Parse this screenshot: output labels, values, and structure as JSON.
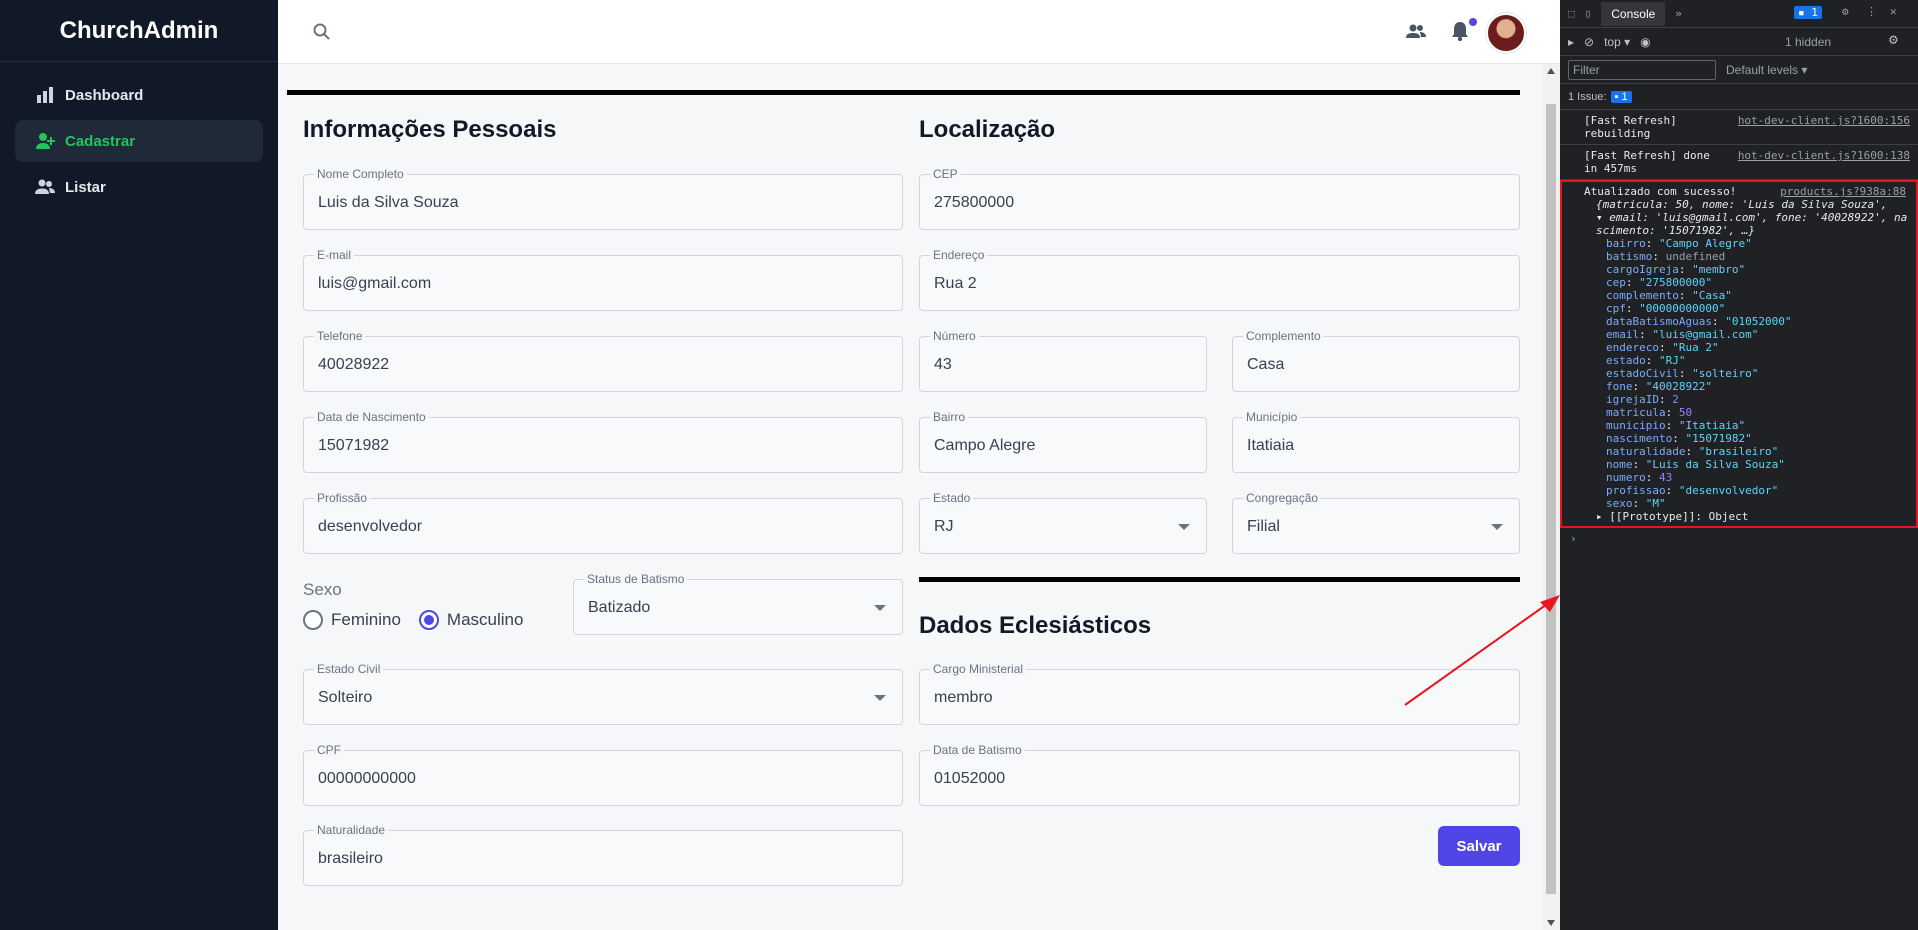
{
  "app": {
    "name": "ChurchAdmin"
  },
  "sidebar": {
    "items": [
      {
        "label": "Dashboard",
        "icon": "bar-chart-icon",
        "active": false
      },
      {
        "label": "Cadastrar",
        "icon": "user-plus-icon",
        "active": true
      },
      {
        "label": "Listar",
        "icon": "users-icon",
        "active": false
      }
    ]
  },
  "topbar": {
    "icons": [
      "search-icon",
      "people-icon",
      "bell-icon",
      "avatar"
    ]
  },
  "sections": {
    "personal": "Informações Pessoais",
    "location": "Localização",
    "church": "Dados Eclesiásticos"
  },
  "fields": {
    "nome": {
      "label": "Nome Completo",
      "value": "Luis da Silva Souza"
    },
    "email": {
      "label": "E-mail",
      "value": "luis@gmail.com"
    },
    "telefone": {
      "label": "Telefone",
      "value": "40028922"
    },
    "nascimento": {
      "label": "Data de Nascimento",
      "value": "15071982"
    },
    "profissao": {
      "label": "Profissão",
      "value": "desenvolvedor"
    },
    "status_batismo": {
      "label": "Status de Batismo",
      "value": "Batizado"
    },
    "estado_civil": {
      "label": "Estado Civil",
      "value": "Solteiro"
    },
    "cpf": {
      "label": "CPF",
      "value": "00000000000"
    },
    "naturalidade": {
      "label": "Naturalidade",
      "value": "brasileiro"
    },
    "cep": {
      "label": "CEP",
      "value": "275800000"
    },
    "endereco": {
      "label": "Endereço",
      "value": "Rua 2"
    },
    "numero": {
      "label": "Número",
      "value": "43"
    },
    "complemento": {
      "label": "Complemento",
      "value": "Casa"
    },
    "bairro": {
      "label": "Bairro",
      "value": "Campo Alegre"
    },
    "municipio": {
      "label": "Município",
      "value": "Itatiaia"
    },
    "estado": {
      "label": "Estado",
      "value": "RJ"
    },
    "congregacao": {
      "label": "Congregação",
      "value": "Filial"
    },
    "cargo": {
      "label": "Cargo Ministerial",
      "value": "membro"
    },
    "data_batismo": {
      "label": "Data de Batismo",
      "value": "01052000"
    }
  },
  "sexo": {
    "legend": "Sexo",
    "options": [
      "Feminino",
      "Masculino"
    ],
    "selected": "Masculino"
  },
  "save_label": "Salvar",
  "devtools": {
    "tab": "Console",
    "context": "top",
    "hidden": "1 hidden",
    "filter_placeholder": "Filter",
    "levels": "Default levels",
    "issues": "1 Issue:",
    "issues_count": "1",
    "msg_count": "1",
    "logs": [
      {
        "text1": "[Fast Refresh]",
        "text2": "rebuilding",
        "src": "hot-dev-client.js?1600:156"
      },
      {
        "text1": "[Fast Refresh] done",
        "text2": "in 457ms",
        "src": "hot-dev-client.js?1600:138"
      }
    ],
    "obj": {
      "message": "Atualizado com sucesso!",
      "src": "products.js?938a:88",
      "preview1": "{matricula: 50, nome: 'Luis da Silva Souza',",
      "preview2": "email: 'luis@gmail.com', fone: '40028922', na",
      "preview3": "scimento: '15071982', …}",
      "props": [
        {
          "k": "bairro",
          "v": "\"Campo Alegre\"",
          "t": "s"
        },
        {
          "k": "batismo",
          "v": "undefined",
          "t": "u"
        },
        {
          "k": "cargoIgreja",
          "v": "\"membro\"",
          "t": "s"
        },
        {
          "k": "cep",
          "v": "\"275800000\"",
          "t": "s"
        },
        {
          "k": "complemento",
          "v": "\"Casa\"",
          "t": "s"
        },
        {
          "k": "cpf",
          "v": "\"00000000000\"",
          "t": "s"
        },
        {
          "k": "dataBatismoAguas",
          "v": "\"01052000\"",
          "t": "s"
        },
        {
          "k": "email",
          "v": "\"luis@gmail.com\"",
          "t": "s"
        },
        {
          "k": "endereco",
          "v": "\"Rua 2\"",
          "t": "s"
        },
        {
          "k": "estado",
          "v": "\"RJ\"",
          "t": "s"
        },
        {
          "k": "estadoCivil",
          "v": "\"solteiro\"",
          "t": "s"
        },
        {
          "k": "fone",
          "v": "\"40028922\"",
          "t": "s"
        },
        {
          "k": "igrejaID",
          "v": "2",
          "t": "n"
        },
        {
          "k": "matricula",
          "v": "50",
          "t": "n"
        },
        {
          "k": "municipio",
          "v": "\"Itatiaia\"",
          "t": "s"
        },
        {
          "k": "nascimento",
          "v": "\"15071982\"",
          "t": "s"
        },
        {
          "k": "naturalidade",
          "v": "\"brasileiro\"",
          "t": "s"
        },
        {
          "k": "nome",
          "v": "\"Luis da Silva Souza\"",
          "t": "s"
        },
        {
          "k": "numero",
          "v": "43",
          "t": "n"
        },
        {
          "k": "profissao",
          "v": "\"desenvolvedor\"",
          "t": "s"
        },
        {
          "k": "sexo",
          "v": "\"M\"",
          "t": "s"
        }
      ],
      "prototype": "[[Prototype]]: Object"
    }
  },
  "colors": {
    "sidebar": "#111827",
    "accent": "#4f46e5",
    "active_green": "#22c55e",
    "annotation_red": "#e8151b"
  }
}
